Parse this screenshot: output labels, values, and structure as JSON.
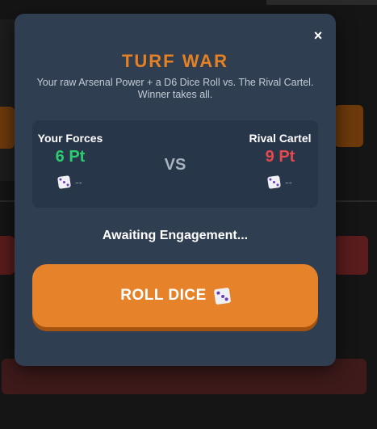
{
  "modal": {
    "title": "TURF WAR",
    "description": "Your raw Arsenal Power + a D6 Dice Roll vs. The Rival Cartel. Winner takes all.",
    "close_icon": "×"
  },
  "player": {
    "name": "Your Forces",
    "points": "6 Pt",
    "dice_value": "--",
    "points_color": "#2ecc71"
  },
  "rival": {
    "name": "Rival Cartel",
    "points": "9 Pt",
    "dice_value": "--",
    "points_color": "#e5484d"
  },
  "vs_label": "VS",
  "status": "Awaiting Engagement...",
  "roll_button": {
    "label": "ROLL DICE",
    "icon": "dice-icon",
    "color": "#e6832a"
  },
  "accent_color": "#e58123"
}
